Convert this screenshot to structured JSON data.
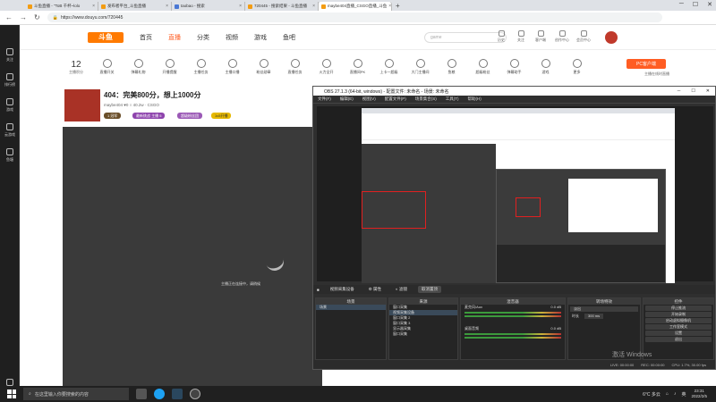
{
  "browser": {
    "tabs": [
      {
        "label": "斗鱼直播 - \"ToB 千杯~lolo"
      },
      {
        "label": "发布者平台_斗鱼直播"
      },
      {
        "label": "taobao - 搜索"
      },
      {
        "label": "720445 - 搜索结果 - 斗鱼直播"
      },
      {
        "label": "maybe404直播_CSGO直播_斗鱼",
        "active": true
      }
    ],
    "new_tab": "+",
    "url": "https://www.douyu.com/720445"
  },
  "rail": {
    "items": [
      "关注",
      "排行榜",
      "游戏",
      "云游戏",
      "鱼塘",
      "客服"
    ]
  },
  "site": {
    "logo": "斗鱼",
    "nav": [
      "首页",
      "直播",
      "分类",
      "视频",
      "游戏",
      "鱼吧"
    ],
    "active_nav": "直播",
    "search_placeholder": "game",
    "header_icons": [
      "历史",
      "关注",
      "客户端",
      "创作中心",
      "会员中心"
    ],
    "tools_count": "12",
    "tools_count_label": "主播积分",
    "tools": [
      "直播开关",
      "弹幕礼物",
      "开播提醒",
      "主播任务",
      "主播口播",
      "粉丝勋章",
      "直播任务",
      "火力全开",
      "直播间PK",
      "上卡一超级",
      "大门主播间",
      "鱼粮",
      "超级粉丝",
      "弹幕助手",
      "游戏",
      "更多"
    ],
    "pc_button": "PC客户端",
    "pc_link": "主播在线时直播",
    "room": {
      "title": "404：完美800分，想上1000分",
      "meta": "maybe404  ♥0  ○ 40.2w",
      "category": "CSGO",
      "badges": [
        "1 冠军",
        "最新挑战 主播 5",
        "超级粉丝团",
        "1v5开播"
      ]
    },
    "video_hint": "主播正在连接中，请稍候"
  },
  "obs": {
    "title": "OBS 27.1.3 (64-bit, windows) - 配置文件: 未命名 - 场景: 未命名",
    "menu": [
      "文件(F)",
      "编辑(E)",
      "视图(V)",
      "配置文件(P)",
      "场景集合(S)",
      "工具(T)",
      "帮助(H)"
    ],
    "dock_tabs": [
      "视频采集设备",
      "属性",
      "滤镜",
      "取消置顶"
    ],
    "scenes_header": "场景",
    "scenes": [
      "场景"
    ],
    "sources_header": "来源",
    "sources": [
      "窗口采集",
      "视频采集设备",
      "窗口采集 2",
      "窗口采集 3",
      "显示器采集",
      "窗口采集"
    ],
    "mixer_header": "混音器",
    "mixer": [
      {
        "name": "麦克风/Aux",
        "db": "0.0 dB"
      },
      {
        "name": "桌面音频",
        "db": "0.0 dB"
      }
    ],
    "transitions_header": "转场特效",
    "transition_value": "淡出",
    "duration_label": "时长",
    "duration_value": "300 ms",
    "controls_header": "控件",
    "controls": [
      "停止推流",
      "开始录制",
      "启动虚拟摄像机",
      "工作室模式",
      "设置",
      "退出"
    ],
    "status": [
      "LIVE: 00:00:00",
      "REC: 00:00:00",
      "CPU: 1.7%, 30.00 fps"
    ],
    "watermark": "激活 Windows"
  },
  "taskbar": {
    "search_placeholder": "在这里输入你要搜索的内容",
    "tray_temp": "6°C 多云",
    "tray_lang": "英",
    "time": "23:31",
    "date": "2022/2/5"
  }
}
